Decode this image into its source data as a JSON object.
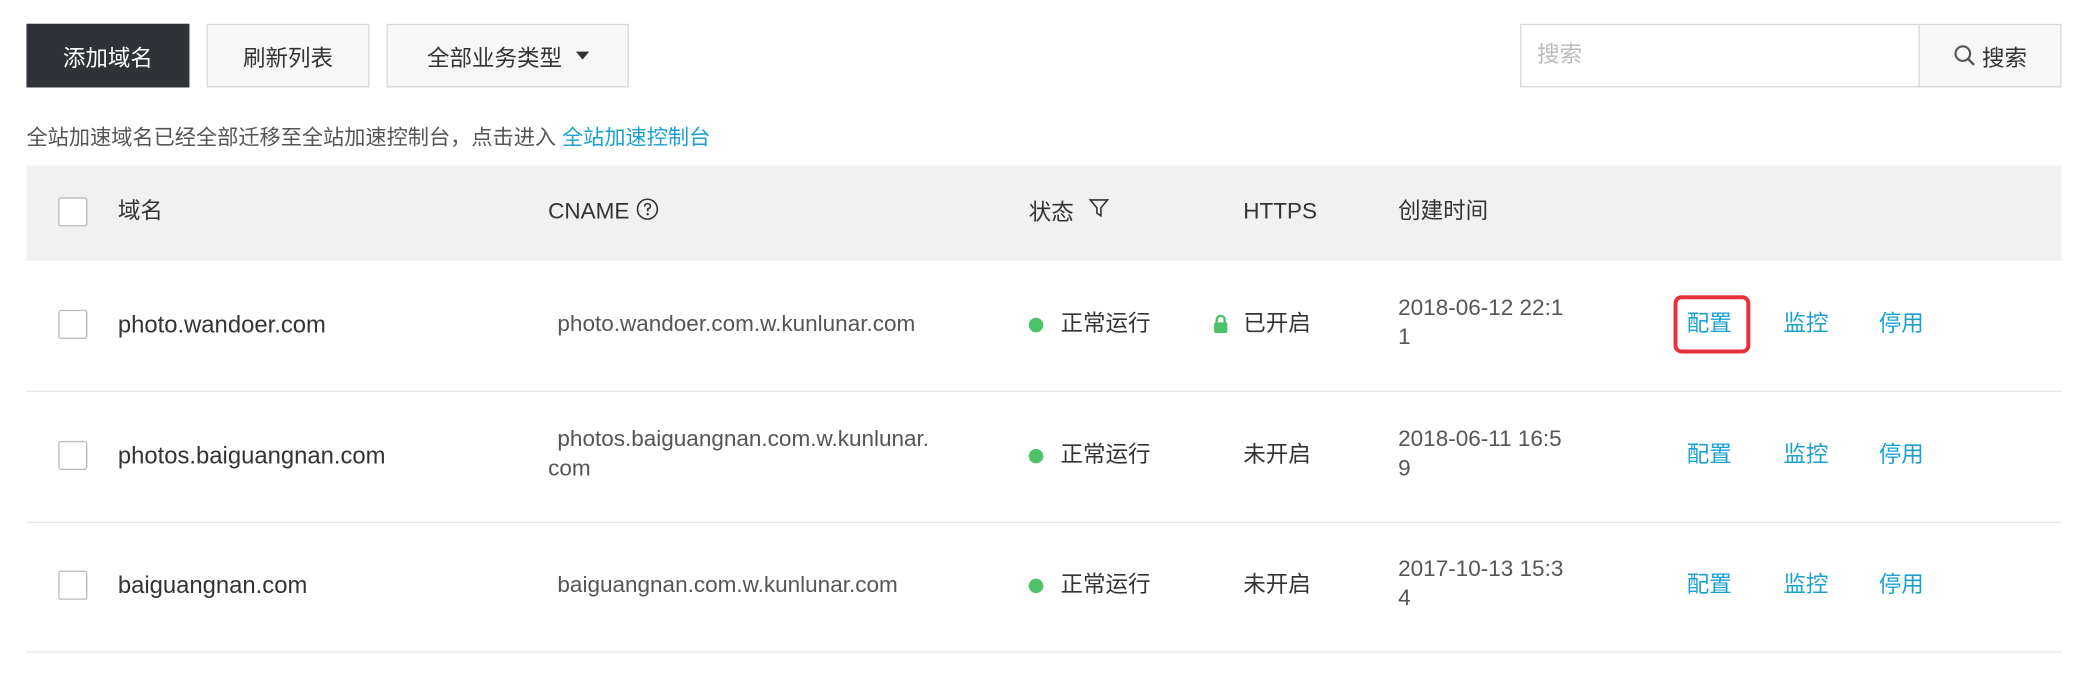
{
  "toolbar": {
    "add_domain": "添加域名",
    "refresh_list": "刷新列表",
    "business_type": "全部业务类型",
    "search_placeholder": "搜索",
    "search_button": "搜索"
  },
  "notice": {
    "text": "全站加速域名已经全部迁移至全站加速控制台，点击进入",
    "link": "全站加速控制台"
  },
  "table": {
    "headers": {
      "domain": "域名",
      "cname": "CNAME",
      "status": "状态",
      "https": "HTTPS",
      "created": "创建时间"
    },
    "rows": [
      {
        "domain": "photo.wandoer.com",
        "cname_line1": "photo.wandoer.com.w.kunlunar.com",
        "cname_line2": "",
        "status": "正常运行",
        "https": "已开启",
        "created_line1": "2018-06-12 22:1",
        "created_line2": "1",
        "actions": {
          "config": "配置",
          "monitor": "监控",
          "disable": "停用"
        }
      },
      {
        "domain": "photos.baiguangnan.com",
        "cname_line1": "photos.baiguangnan.com.w.kunlunar.",
        "cname_line2": "com",
        "status": "正常运行",
        "https": "未开启",
        "created_line1": "2018-06-11 16:5",
        "created_line2": "9",
        "actions": {
          "config": "配置",
          "monitor": "监控",
          "disable": "停用"
        }
      },
      {
        "domain": "baiguangnan.com",
        "cname_line1": "baiguangnan.com.w.kunlunar.com",
        "cname_line2": "",
        "status": "正常运行",
        "https": "未开启",
        "created_line1": "2017-10-13 15:3",
        "created_line2": "4",
        "actions": {
          "config": "配置",
          "monitor": "监控",
          "disable": "停用"
        }
      }
    ]
  },
  "colors": {
    "accent": "#1ba1d0",
    "status_ok": "#4cc36b",
    "highlight": "#e5313a",
    "primary_button": "#2f3337"
  }
}
